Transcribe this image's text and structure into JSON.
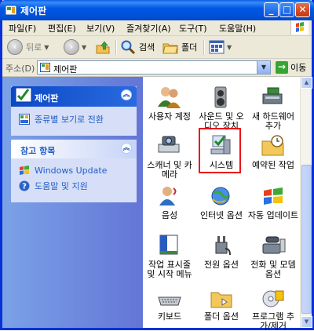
{
  "window": {
    "title": "제어판"
  },
  "menu": [
    "파일(F)",
    "편집(E)",
    "보기(V)",
    "즐겨찾기(A)",
    "도구(T)",
    "도움말(H)"
  ],
  "toolbar": {
    "back": "뒤로",
    "search": "검색",
    "folders": "폴더"
  },
  "address": {
    "label": "주소(D)",
    "value": "제어판",
    "go": "이동"
  },
  "control_panel_box": {
    "title": "제어판",
    "switch_link": "종류별 보기로 전환"
  },
  "see_also": {
    "title": "참고 항목",
    "links": [
      "Windows Update",
      "도움말 및 지원"
    ]
  },
  "items": [
    {
      "label": "사용자 계정",
      "icon": "users-icon"
    },
    {
      "label": "사운드 및 오디오 장치",
      "icon": "speaker-icon"
    },
    {
      "label": "새 하드웨어 추가",
      "icon": "hardware-icon"
    },
    {
      "label": "스캐너 및 카메라",
      "icon": "scanner-icon"
    },
    {
      "label": "시스템",
      "icon": "system-icon"
    },
    {
      "label": "예약된 작업",
      "icon": "scheduled-tasks-icon"
    },
    {
      "label": "음성",
      "icon": "speech-icon"
    },
    {
      "label": "인터넷 옵션",
      "icon": "internet-icon"
    },
    {
      "label": "자동 업데이트",
      "icon": "windows-update-icon"
    },
    {
      "label": "작업 표시줄 및 시작 메뉴",
      "icon": "taskbar-icon"
    },
    {
      "label": "전원 옵션",
      "icon": "power-icon"
    },
    {
      "label": "전화 및 모뎀 옵션",
      "icon": "phone-icon"
    },
    {
      "label": "키보드",
      "icon": "keyboard-icon"
    },
    {
      "label": "폴더 옵션",
      "icon": "folder-options-icon"
    },
    {
      "label": "프로그램 추가/제거",
      "icon": "add-remove-icon"
    }
  ]
}
